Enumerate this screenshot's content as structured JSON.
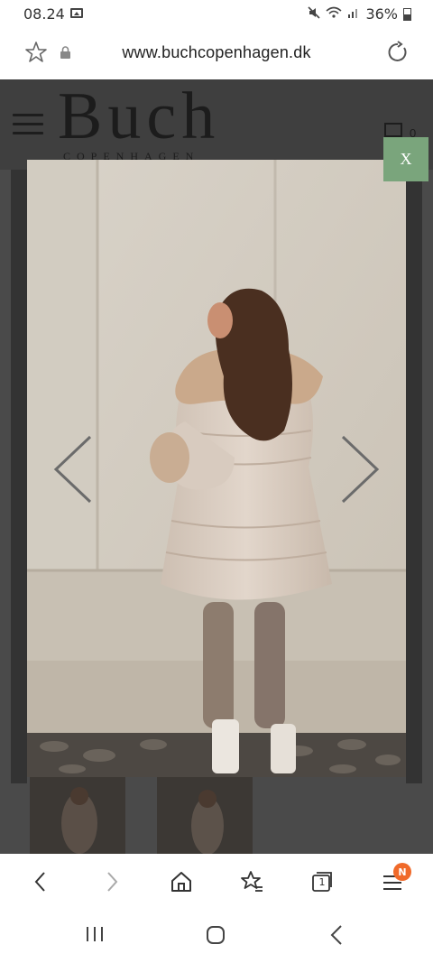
{
  "status_bar": {
    "time": "08.24",
    "battery": "36%",
    "icons": [
      "gallery-icon",
      "mute-icon",
      "wifi-icon",
      "signal-icon",
      "battery-icon"
    ]
  },
  "url_bar": {
    "url": "www.buchcopenhagen.dk",
    "icons": [
      "favorite-star-icon",
      "lock-icon",
      "reload-icon"
    ]
  },
  "site": {
    "logo_main": "Buch",
    "logo_sub": "COPENHAGEN",
    "icons": [
      "hamburger-menu-icon",
      "cart-icon"
    ]
  },
  "lightbox": {
    "close_label": "X",
    "icons": [
      "chevron-left-icon",
      "chevron-right-icon"
    ],
    "image_subject": "woman in beige puffer jacket with fur hood against white wall"
  },
  "toolbar": {
    "tab_count": "1",
    "badge": "N",
    "icons": [
      "back-icon",
      "forward-icon",
      "home-icon",
      "bookmarks-icon",
      "tabs-icon",
      "menu-icon"
    ]
  },
  "system_nav": {
    "icons": [
      "recents-icon",
      "home-circle-icon",
      "nav-back-icon"
    ]
  },
  "colors": {
    "close_button": "#7aa57c",
    "badge": "#f06a2a",
    "overlay": "#4a4a4a"
  }
}
